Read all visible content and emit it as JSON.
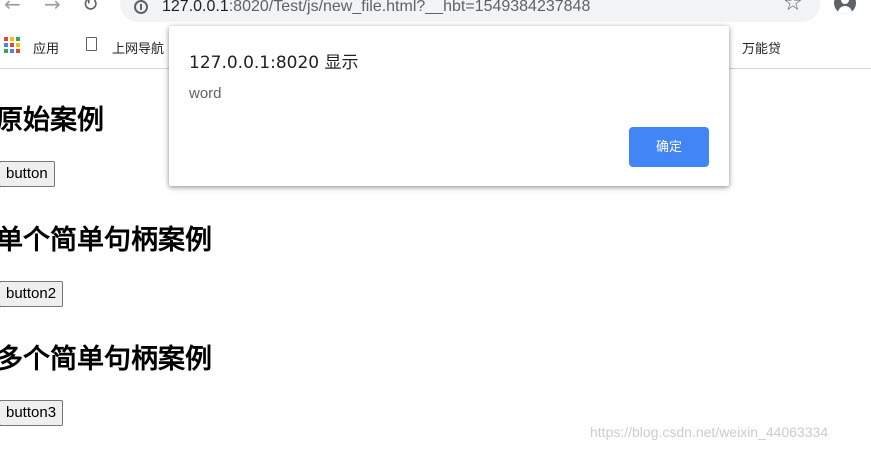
{
  "browser": {
    "url_host": "127.0.0.1",
    "url_rest": ":8020/Test/js/new_file.html?__hbt=1549384237848"
  },
  "bookmarks": {
    "apps_label": "应用",
    "item1": "上网导航",
    "item2": "万能贷",
    "apps_colors": [
      "#ea4335",
      "#fbbc05",
      "#34a853",
      "#4285f4",
      "#ea4335",
      "#fbbc05",
      "#34a853",
      "#4285f4",
      "#ea4335"
    ]
  },
  "page": {
    "heading1": "原始案例",
    "button1": "button",
    "heading2": "单个简单句柄案例",
    "button2": "button2",
    "heading3": "多个简单句柄案例",
    "button3": "button3"
  },
  "dialog": {
    "title": "127.0.0.1:8020 显示",
    "message": "word",
    "ok_label": "确定",
    "ok_color": "#4285f4"
  },
  "watermark": "https://blog.csdn.net/weixin_44063334"
}
